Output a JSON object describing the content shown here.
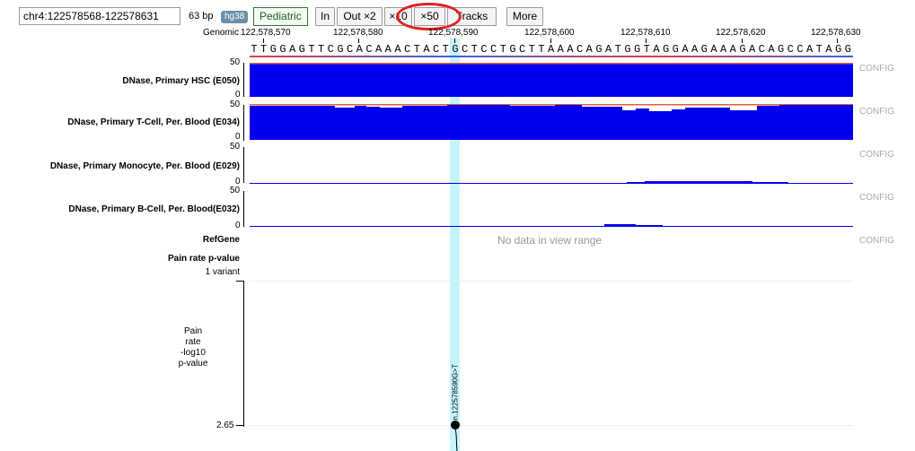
{
  "toolbar": {
    "coord_value": "chr4:122578568-122578631",
    "bp_label": "63 bp",
    "genome": "hg38",
    "dataset_label": "Pediatric",
    "buttons": [
      {
        "id": "in",
        "label": "In"
      },
      {
        "id": "out2",
        "label": "Out ×2"
      },
      {
        "id": "x10",
        "label": "×10"
      },
      {
        "id": "x50",
        "label": "×50"
      },
      {
        "id": "tracks",
        "label": "Tracks"
      },
      {
        "id": "more",
        "label": "More"
      }
    ]
  },
  "ruler": {
    "label": "Genomic",
    "positions": [
      "122,578,570",
      "122,578,580",
      "122,578,590",
      "122,578,600",
      "122,578,610",
      "122,578,620",
      "122,578,630"
    ]
  },
  "sequence": "TTGGAGTTCGCACAAACTACTGCTCCTGCTTAAACAGATGGTAGGAAGAAAGACAGCCATAGG",
  "tracks": [
    {
      "label": "DNase, Primary HSC (E050)",
      "ymax": "50",
      "ymin": "0",
      "config": "CONFIG"
    },
    {
      "label": "DNase, Primary T-Cell, Per. Blood (E034)",
      "ymax": "50",
      "ymin": "0",
      "config": "CONFIG"
    },
    {
      "label": "DNase, Primary Monocyte, Per. Blood (E029)",
      "ymax": "50",
      "ymin": "0",
      "config": "CONFIG"
    },
    {
      "label": "DNase, Primary B-Cell, Per. Blood(E032)",
      "ymax": "50",
      "ymin": "0",
      "config": "CONFIG"
    }
  ],
  "refgene": {
    "label": "RefGene",
    "message": "No data in view range",
    "config": "CONFIG"
  },
  "pvalue": {
    "title": "Pain rate p-value",
    "variants": "1 variant",
    "axis_label": [
      "Pain",
      "rate",
      "-log10",
      "p-value"
    ],
    "tick": "2.65",
    "variant_label": "n.122578590G>T"
  },
  "colors": {
    "signal": "#0000ee",
    "highlight": "#b8f1fb",
    "oval": "#e02020",
    "top_marker": "#e06040"
  }
}
